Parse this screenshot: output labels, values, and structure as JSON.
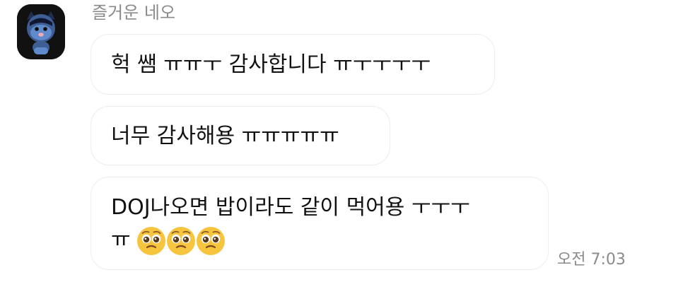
{
  "sender": {
    "name": "즐거운 네오"
  },
  "messages": [
    {
      "text": "헉 쌤 ㅠㅠㅜ 감사합니다 ㅠㅜㅜㅜㅜ"
    },
    {
      "text": "너무 감사해용 ㅠㅠㅠㅠㅠ"
    },
    {
      "line1": "DOJ나오면 밥이라도 같이 먹어용 ㅜㅜㅜ",
      "line2": "ㅠ",
      "emojis": [
        "pleading-face-icon",
        "pleading-face-icon",
        "pleading-face-icon"
      ]
    }
  ],
  "timestamp": "오전 7:03",
  "colors": {
    "background": "#ffffff",
    "bubble_border": "#ececec",
    "meta_text": "#8a8a8a",
    "avatar_bg": "#111111",
    "avatar_character": "#3f5e93",
    "emoji_face": "#f7c43d"
  }
}
